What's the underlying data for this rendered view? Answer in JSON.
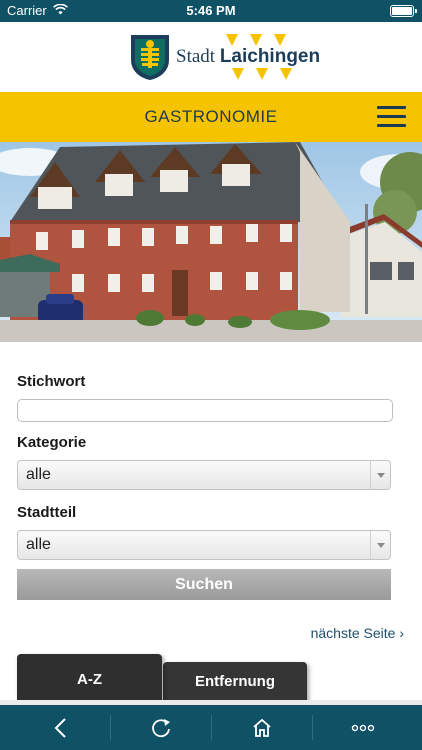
{
  "status_bar": {
    "carrier": "Carrier",
    "time": "5:46 PM",
    "icons": [
      "wifi-icon",
      "battery-icon"
    ]
  },
  "header": {
    "logo_word_1": "Stadt",
    "logo_word_2": "Laichingen",
    "colors": {
      "brand_blue": "#1c3e5a",
      "brand_yellow": "#f5c300"
    }
  },
  "title_bar": {
    "title": "GASTRONOMIE",
    "menu_icon": "hamburger-menu-icon"
  },
  "form": {
    "keyword_label": "Stichwort",
    "keyword_value": "",
    "category_label": "Kategorie",
    "category_selected": "alle",
    "district_label": "Stadtteil",
    "district_selected": "alle",
    "search_button": "Suchen"
  },
  "pagination": {
    "next_label": "nächste Seite ›"
  },
  "tabs": [
    {
      "label": "A-Z",
      "active": true
    },
    {
      "label": "Entfernung",
      "active": false
    }
  ],
  "toolbar": {
    "icons": [
      "back-icon",
      "reload-icon",
      "home-icon",
      "more-icon"
    ],
    "color": "#0f5266"
  }
}
